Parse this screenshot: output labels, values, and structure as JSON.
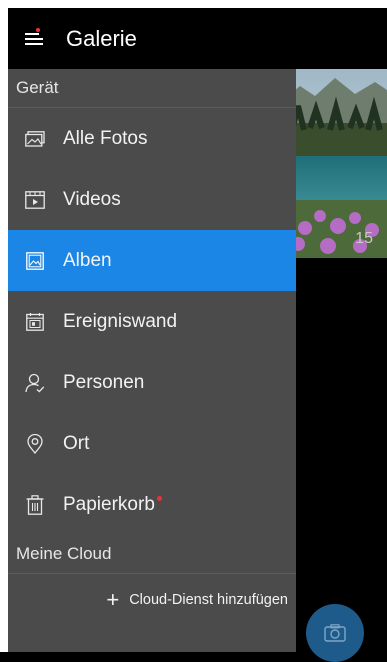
{
  "app": {
    "title": "Galerie"
  },
  "drawer": {
    "section_device": "Gerät",
    "items": [
      {
        "label": "Alle Fotos",
        "icon": "photos-icon"
      },
      {
        "label": "Videos",
        "icon": "video-icon"
      },
      {
        "label": "Alben",
        "icon": "album-icon",
        "active": true
      },
      {
        "label": "Ereigniswand",
        "icon": "event-wall-icon"
      },
      {
        "label": "Personen",
        "icon": "person-icon"
      },
      {
        "label": "Ort",
        "icon": "location-pin-icon"
      },
      {
        "label": "Papierkorb",
        "icon": "trash-icon"
      }
    ],
    "section_cloud": "Meine Cloud",
    "add_cloud_label": "Cloud-Dienst hinzufügen"
  },
  "background": {
    "photo_count": "15"
  },
  "colors": {
    "accent": "#1c86e6",
    "drawer_bg": "#4b4b4b",
    "badge": "#e8333a"
  }
}
